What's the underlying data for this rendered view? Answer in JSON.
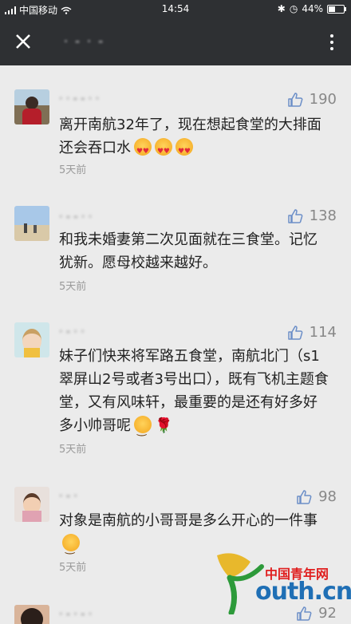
{
  "status": {
    "carrier": "中国移动",
    "time": "14:54",
    "battery": "44%",
    "battery_level": 0.44
  },
  "header": {
    "title": "· - · -"
  },
  "comments": [
    {
      "name": "· · - - · ·",
      "likes": "190",
      "text": "离开南航32年了，现在想起食堂的大排面还会吞口水",
      "emoji": [
        "heart-eyes",
        "heart-eyes",
        "heart-eyes"
      ],
      "time": "5天前"
    },
    {
      "name": "· - - · ·",
      "likes": "138",
      "text": "和我未婚妻第二次见面就在三食堂。记忆犹新。愿母校越来越好。",
      "emoji": [],
      "time": "5天前"
    },
    {
      "name": "· - · ·",
      "likes": "114",
      "text": "妹子们快来将军路五食堂，南航北门（s1翠屏山2号或者3号出口），既有飞机主题食堂，又有风味轩，最重要的是还有好多好多小帅哥呢",
      "emoji": [
        "smile",
        "rose"
      ],
      "time": "5天前"
    },
    {
      "name": "· - ·",
      "likes": "98",
      "text": "对象是南航的小哥哥是多么开心的一件事",
      "emoji": [
        "smile"
      ],
      "time": "5天前"
    },
    {
      "name": "· - · - ·",
      "likes": "92",
      "text": "",
      "emoji": [],
      "time": ""
    }
  ],
  "watermark": {
    "brand": "中国青年网",
    "domain": "outh.cn"
  },
  "colors": {
    "header_bg": "#2e3033",
    "page_bg": "#ebebeb",
    "like_blue": "#6c8fc8"
  }
}
